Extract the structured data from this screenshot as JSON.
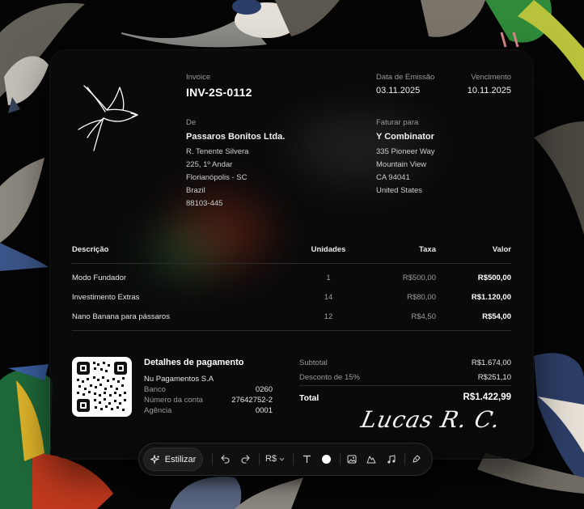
{
  "invoice": {
    "label": "Invoice",
    "number": "INV-2S-0112",
    "issue_date_label": "Data de Emissão",
    "issue_date": "03.11.2025",
    "due_label": "Vencimento",
    "due_date": "10.11.2025"
  },
  "from": {
    "label": "De",
    "company": "Passaros Bonitos Ltda.",
    "lines": [
      "R. Tenente Silvera",
      "225, 1º Andar",
      "Florianópolis - SC",
      "Brazil",
      "88103-445"
    ]
  },
  "bill_to": {
    "label": "Faturar para",
    "company": "Y Combinator",
    "lines": [
      "335 Pioneer Way",
      "Mountain View",
      "CA 94041",
      "United States"
    ]
  },
  "table": {
    "headers": [
      "Descrição",
      "Unidades",
      "Taxa",
      "Valor"
    ],
    "rows": [
      {
        "description": "Modo Fundador",
        "units": "1",
        "rate": "R$500,00",
        "amount": "R$500,00"
      },
      {
        "description": "Investimento Extras",
        "units": "14",
        "rate": "R$80,00",
        "amount": "R$1.120,00"
      },
      {
        "description": "Nano Banana para pássaros",
        "units": "12",
        "rate": "R$4,50",
        "amount": "R$54,00"
      }
    ]
  },
  "payment": {
    "title": "Detalhes de pagamento",
    "bank_name": "Nu Pagamentos S.A",
    "rows": [
      {
        "label": "Banco",
        "value": "0260"
      },
      {
        "label": "Número da conta",
        "value": "27642752-2"
      },
      {
        "label": "Agência",
        "value": "0001"
      }
    ]
  },
  "totals": {
    "subtotal_label": "Subtotal",
    "subtotal": "R$1.674,00",
    "discount_label": "Desconto de 15%",
    "discount": "R$251,10",
    "total_label": "Total",
    "total": "R$1.422,99"
  },
  "signature": "Lucas R. C.",
  "toolbar": {
    "style_label": "Estilizar",
    "currency_label": "R$",
    "color_swatch": "#ffffff"
  },
  "colors": {
    "background": "#050505",
    "card": "#0c0c0c",
    "text": "#f0f0f0",
    "muted": "#9a9a9a"
  },
  "icons": [
    "sparkle-icon",
    "undo-icon",
    "redo-icon",
    "chevron-down-icon",
    "text-icon",
    "color-dot-icon",
    "image-icon",
    "shape-icon",
    "music-icon",
    "pen-tool-icon",
    "swallow-logo-icon",
    "qr-code-icon"
  ]
}
